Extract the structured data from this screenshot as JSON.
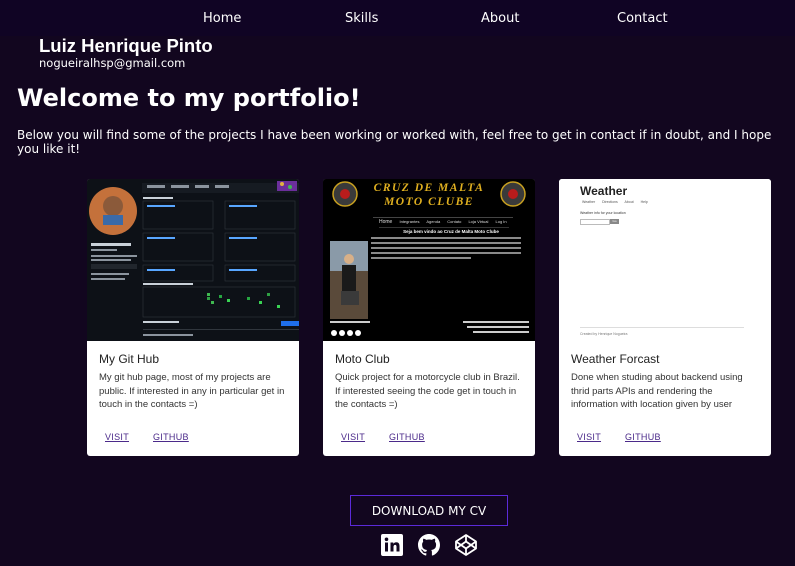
{
  "nav": {
    "items": [
      "Home",
      "Skills",
      "About",
      "Contact"
    ]
  },
  "brand": {
    "name": "Luiz Henrique Pinto",
    "email": "nogueiralhsp@gmail.com"
  },
  "hero": {
    "title": "Welcome to my portfolio!",
    "intro": "Below you will find some of the projects I have been working or worked with, feel free to get in contact if in doubt, and I hope you like it!"
  },
  "projects": [
    {
      "title": "My Git Hub",
      "description": "My git hub page, most of my projects are public. If interested in any in particular get in touch in the contacts =)",
      "visit_label": "VISIT",
      "github_label": "GITHUB",
      "preview": {
        "profile_name": "Luiz Henrique Pinto",
        "profile_user": "nogueiralhsp",
        "button": "Edit profile"
      }
    },
    {
      "title": "Moto Club",
      "description": "Quick project for a motorcycle club in Brazil. If interested seeing the code get in touch in the contacts =)",
      "visit_label": "VISIT",
      "github_label": "GITHUB",
      "preview": {
        "banner_line1": "CRUZ DE MALTA",
        "banner_line2": "MOTO CLUBE",
        "menu": [
          "Home",
          "Integrantes",
          "Agenda",
          "Contato",
          "Loja Virtual",
          "Log In"
        ],
        "welcome": "Seja bem vindo ao Cruz de Malta Moto Clube"
      }
    },
    {
      "title": "Weather Forcast",
      "description": "Done when studing about backend using thrid parts APIs and rendering the information with location given by user",
      "visit_label": "VISIT",
      "github_label": "GITHUB",
      "preview": {
        "heading": "Weather",
        "menu": [
          "Weather",
          "Directions",
          "About",
          "Help"
        ],
        "prompt": "Weather info for your location",
        "button": "Go",
        "footer": "Created by Henrique Nogueira"
      }
    }
  ],
  "cv": {
    "label": "DOWNLOAD MY CV"
  },
  "social": [
    "linkedin-icon",
    "github-icon",
    "codepen-icon"
  ],
  "colors": {
    "background": "#12061f",
    "nav": "#100424",
    "cv_border": "#5b2ad8",
    "link": "#4b2a8a"
  }
}
